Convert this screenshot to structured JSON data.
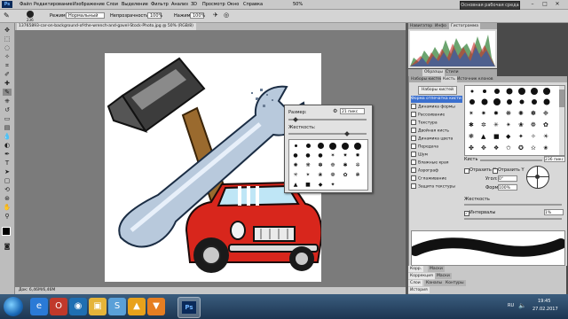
{
  "app": {
    "logo": "Ps",
    "menu": [
      "Файл",
      "Редактирование",
      "Изображение",
      "Слои",
      "Выделение",
      "Фильтр",
      "Анализ",
      "3D",
      "Просмотр",
      "Окно",
      "Справка"
    ],
    "zoom": "50%",
    "workspace": "Основная рабочая среда",
    "window_controls": [
      "–",
      "□",
      "✕"
    ]
  },
  "options_bar": {
    "brush_size": "236",
    "mode_label": "Режим:",
    "mode_value": "Нормальный",
    "opacity_label": "Непрозрачность:",
    "opacity_value": "100%",
    "flow_label": "Нажим:",
    "flow_value": "100%"
  },
  "document": {
    "tab_title": "13765893-car-on-background-of-the-wrench-and-gavel-Stock-Photo.jpg @ 50% (RGB/8)",
    "status": "Док: 6,46M/6,46M"
  },
  "brush_popup": {
    "size_label": "Размер:",
    "size_value": "21 пикс",
    "hardness_label": "Жесткость:"
  },
  "histogram_panel": {
    "tabs": [
      "Навигатор",
      "Инфо",
      "Гистограмма"
    ]
  },
  "properties_tabs": [
    "Образцы",
    "Стили"
  ],
  "brush_panel": {
    "tabs": [
      "Наборы кистей",
      "Кисть",
      "Источник клонов"
    ],
    "presets_button": "Наборы кистей",
    "options": [
      {
        "label": "Форма отпечатка кисти",
        "selected": true
      },
      {
        "label": "Динамика формы",
        "selected": false
      },
      {
        "label": "Рассеивание",
        "selected": false
      },
      {
        "label": "Текстура",
        "selected": false
      },
      {
        "label": "Двойная кисть",
        "selected": false
      },
      {
        "label": "Динамика цвета",
        "selected": false
      },
      {
        "label": "Передача",
        "selected": false
      },
      {
        "label": "Шум",
        "selected": false
      },
      {
        "label": "Влажные края",
        "selected": false
      },
      {
        "label": "Аэрограф",
        "selected": false
      },
      {
        "label": "Сглаживание",
        "selected": false
      },
      {
        "label": "Защита текстуры",
        "selected": false
      }
    ],
    "size_label": "Кисть",
    "size_value": "236 пикс",
    "flip_x": "Отразить X",
    "flip_y": "Отразить Y",
    "angle_label": "Угол:",
    "angle_value": "0°",
    "roundness_label": "Форма:",
    "roundness_value": "100%",
    "hardness_label": "Жесткость",
    "spacing_label": "Интервалы",
    "spacing_value": "1%"
  },
  "bottom_panels": {
    "row1": [
      "Корр.",
      "Маски"
    ],
    "row2": [
      "Коррекция",
      "Маски"
    ],
    "row3": [
      "Слои",
      "Каналы",
      "Контуры"
    ],
    "row4": [
      "История"
    ]
  },
  "taskbar": {
    "lang": "RU",
    "time": "19:45",
    "date": "27.02.2017"
  }
}
